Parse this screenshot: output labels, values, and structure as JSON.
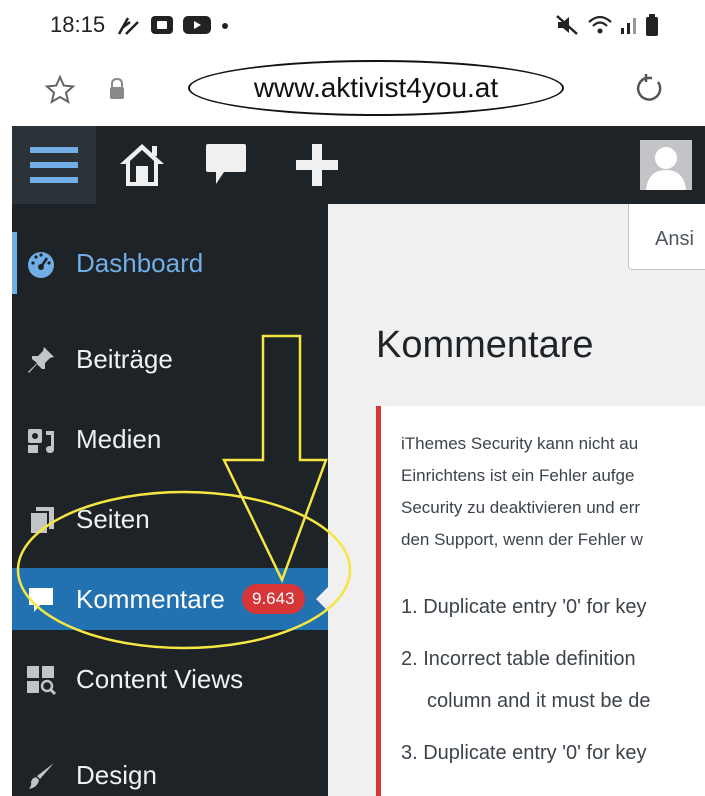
{
  "status_bar": {
    "time": "18:15"
  },
  "url_bar": {
    "url": "www.aktivist4you.at"
  },
  "sidebar": {
    "items": [
      {
        "label": "Dashboard",
        "icon": "dashboard-icon"
      },
      {
        "label": "Beiträge",
        "icon": "pin-icon"
      },
      {
        "label": "Medien",
        "icon": "media-icon"
      },
      {
        "label": "Seiten",
        "icon": "pages-icon"
      },
      {
        "label": "Kommentare",
        "icon": "comment-icon",
        "badge": "9.643"
      },
      {
        "label": "Content Views",
        "icon": "content-views-icon"
      },
      {
        "label": "Design",
        "icon": "brush-icon"
      }
    ]
  },
  "content": {
    "screen_options": "Ansi",
    "title": "Kommentare",
    "notice_lines": [
      "iThemes Security kann nicht au",
      "Einrichtens ist ein Fehler aufge",
      "Security zu deaktivieren und err",
      "den Support, wenn der Fehler w"
    ],
    "list_items": [
      "1. Duplicate entry '0' for key",
      "2. Incorrect table definition",
      "column and it must be de",
      "3. Duplicate entry '0' for key"
    ]
  },
  "colors": {
    "admin_bar": "#1d2327",
    "sidebar": "#1d2327",
    "active_item": "#2271b1",
    "highlight_text": "#72aee6",
    "badge": "#d63638",
    "annotation": "#f5e642"
  }
}
